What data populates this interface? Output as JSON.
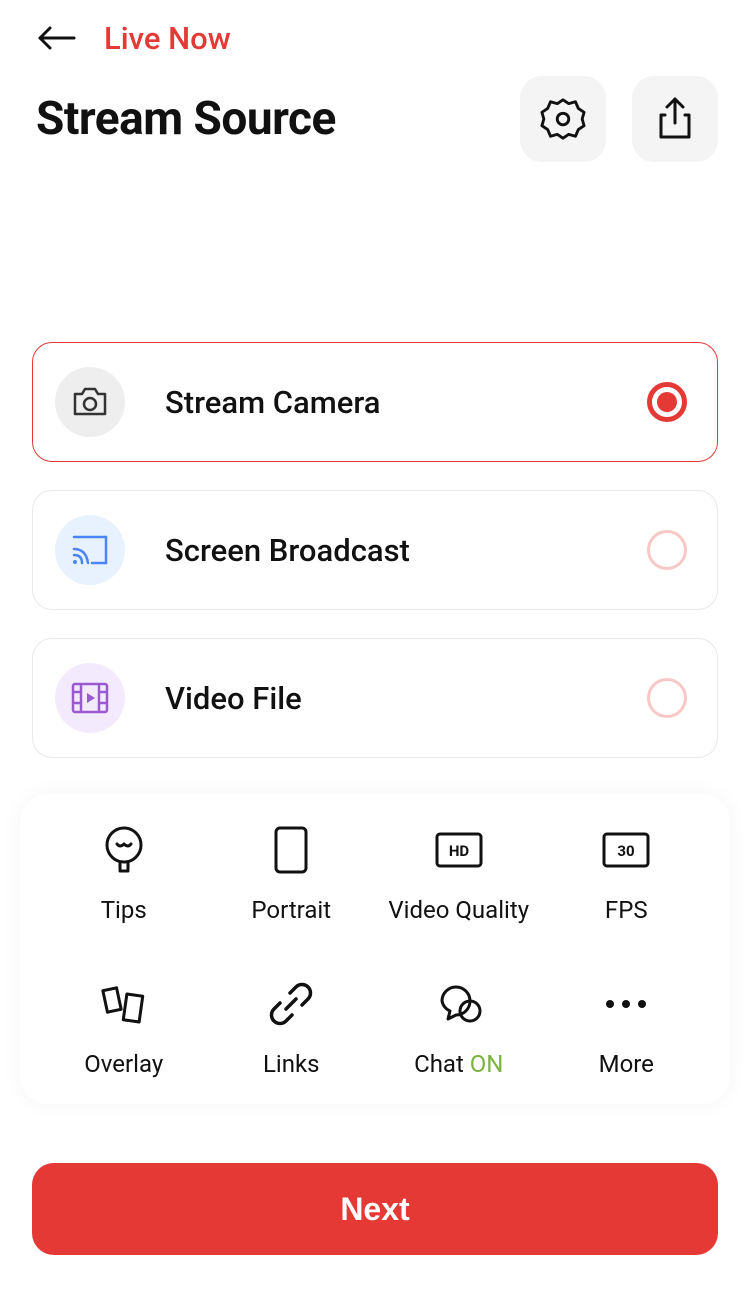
{
  "header": {
    "live_now": "Live Now",
    "title": "Stream Source"
  },
  "sources": [
    {
      "id": "camera",
      "label": "Stream Camera",
      "selected": true,
      "icon": "camera-icon",
      "tint": "grey"
    },
    {
      "id": "screen",
      "label": "Screen Broadcast",
      "selected": false,
      "icon": "cast-icon",
      "tint": "blue"
    },
    {
      "id": "video",
      "label": "Video File",
      "selected": false,
      "icon": "film-icon",
      "tint": "purple"
    }
  ],
  "options": [
    {
      "id": "tips",
      "label": "Tips",
      "icon": "bulb-icon"
    },
    {
      "id": "portrait",
      "label": "Portrait",
      "icon": "portrait-icon"
    },
    {
      "id": "quality",
      "label": "Video Quality",
      "icon": "hd-icon",
      "badge_text": "HD"
    },
    {
      "id": "fps",
      "label": "FPS",
      "icon": "fps-icon",
      "badge_text": "30"
    },
    {
      "id": "overlay",
      "label": "Overlay",
      "icon": "overlay-icon"
    },
    {
      "id": "links",
      "label": "Links",
      "icon": "link-icon"
    },
    {
      "id": "chat",
      "label": "Chat ",
      "icon": "chat-icon",
      "suffix": "ON"
    },
    {
      "id": "more",
      "label": "More",
      "icon": "more-icon"
    }
  ],
  "footer": {
    "next": "Next"
  }
}
